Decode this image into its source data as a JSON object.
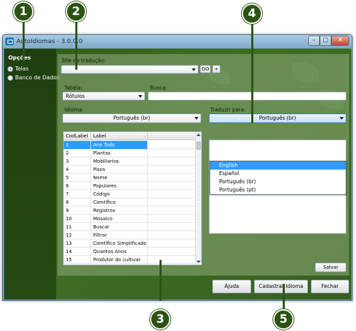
{
  "window": {
    "title": "AutoIdiomas - 3.0.0.0",
    "minimize": "‒",
    "maximize": "□",
    "close": "✕"
  },
  "sidebar": {
    "title": "Opções",
    "options": [
      {
        "label": "Telas",
        "checked": true
      },
      {
        "label": "Banco de Dados",
        "checked": false
      }
    ]
  },
  "site": {
    "label": "Site de tradução:",
    "value": "",
    "go_label": "GO",
    "add_label": "+"
  },
  "tabela": {
    "label": "Tabela:",
    "value": "Rótulos"
  },
  "busca": {
    "label": "Busca:",
    "value": ""
  },
  "idioma": {
    "label": "Idioma:",
    "value": "Português (br)"
  },
  "traduzir": {
    "label": "Traduzir para:",
    "value": "Português (br)",
    "options": [
      "English",
      "Español",
      "Português (br)",
      "Português (pt)"
    ],
    "highlighted": "English"
  },
  "grid": {
    "columns": [
      "CodLabel",
      "Label"
    ],
    "rows": [
      {
        "cod": "1",
        "label": "Ano Todo"
      },
      {
        "cod": "2",
        "label": "Plantas"
      },
      {
        "cod": "3",
        "label": "Mobiliarios"
      },
      {
        "cod": "4",
        "label": "Pisos"
      },
      {
        "cod": "5",
        "label": "Nome"
      },
      {
        "cod": "6",
        "label": "Populares"
      },
      {
        "cod": "7",
        "label": "Código"
      },
      {
        "cod": "8",
        "label": "Científico"
      },
      {
        "cod": "9",
        "label": "Registros"
      },
      {
        "cod": "10",
        "label": "Mosaico"
      },
      {
        "cod": "11",
        "label": "Buscar"
      },
      {
        "cod": "12",
        "label": "Filtrar"
      },
      {
        "cod": "13",
        "label": "Científico Simplificado"
      },
      {
        "cod": "14",
        "label": "Quantos Anos"
      },
      {
        "cod": "15",
        "label": "Produtor do cultivar"
      }
    ],
    "selected_index": 0
  },
  "buttons": {
    "salvar": "Salvar",
    "ajuda": "Ajuda",
    "cadastrar": "Cadastrar Idioma",
    "fechar": "Fechar"
  },
  "callouts": [
    "1",
    "2",
    "3",
    "4",
    "5"
  ],
  "colors": {
    "callout": "#2c5315",
    "selection": "#3399ff",
    "background": "#3f6d24"
  }
}
